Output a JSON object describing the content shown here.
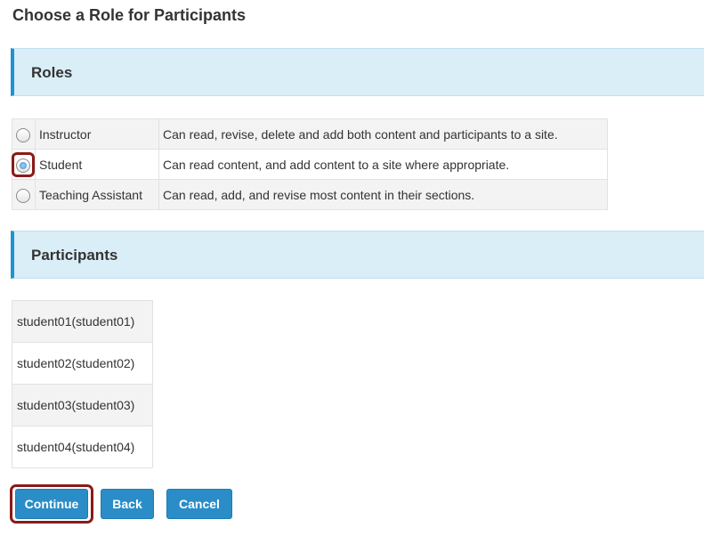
{
  "page": {
    "title": "Choose a Role for Participants"
  },
  "roles_section": {
    "heading": "Roles"
  },
  "roles": [
    {
      "name": "Instructor",
      "description": "Can read, revise, delete and add both content and participants to a site.",
      "selected": false
    },
    {
      "name": "Student",
      "description": "Can read content, and add content to a site where appropriate.",
      "selected": true
    },
    {
      "name": "Teaching Assistant",
      "description": "Can read, add, and revise most content in their sections.",
      "selected": false
    }
  ],
  "participants_section": {
    "heading": "Participants"
  },
  "participants": [
    "student01(student01)",
    "student02(student02)",
    "student03(student03)",
    "student04(student04)"
  ],
  "buttons": {
    "continue": "Continue",
    "back": "Back",
    "cancel": "Cancel"
  },
  "colors": {
    "accent": "#2a8dc8",
    "section_header_bg": "#d9eef7",
    "section_header_border": "#1f94d2",
    "highlight": "#8b1a1a"
  }
}
